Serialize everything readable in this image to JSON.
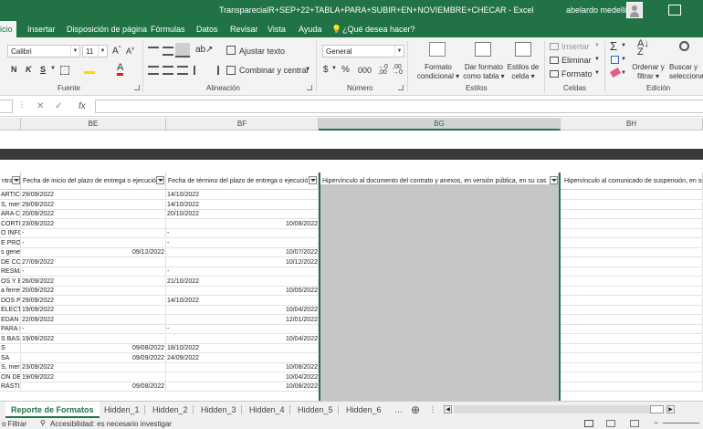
{
  "window": {
    "title": "TransparecialR+SEP+22+TABLA+PARA+SUBIR+EN+NOVIEMBRE+CHECAR  -  Excel",
    "user": "abelardo medellin"
  },
  "tabs": [
    {
      "label": "icio",
      "active": true
    },
    {
      "label": "Insertar"
    },
    {
      "label": "Disposición de página"
    },
    {
      "label": "Fórmulas"
    },
    {
      "label": "Datos"
    },
    {
      "label": "Revisar"
    },
    {
      "label": "Vista"
    },
    {
      "label": "Ayuda"
    },
    {
      "label": "¿Qué desea hacer?"
    }
  ],
  "ribbon": {
    "font_name": "Calibri",
    "font_size": "11",
    "bold": "N",
    "italic": "K",
    "underline": "S",
    "wrap_text": "Ajustar texto",
    "merge_center": "Combinar y centrar",
    "number_format": "General",
    "cond_format": [
      "Formato",
      "condicional"
    ],
    "format_table": [
      "Dar formato",
      "como tabla"
    ],
    "cell_styles": [
      "Estilos de",
      "celda"
    ],
    "insert": "Insertar",
    "delete": "Eliminar",
    "format": "Formato",
    "sort_filter": [
      "Ordenar y",
      "filtrar"
    ],
    "find_select": [
      "Buscar y",
      "seleccionar"
    ],
    "groups": {
      "font": "Fuente",
      "alignment": "Alineación",
      "number": "Número",
      "styles": "Estilos",
      "cells": "Celdas",
      "editing": "Edición"
    }
  },
  "formula_bar": {
    "fx": "fx",
    "value": ""
  },
  "columns": [
    "BE",
    "BF",
    "BG",
    "BH"
  ],
  "headers": {
    "a": "ntra",
    "be": "Fecha de inicio del plazo de entrega o ejecució",
    "bf": "Fecha de término del plazo de entrega o ejecució",
    "bg": "Hipervínculo al documento del contrato y anexos, en versión pública, en su cas",
    "bh": "Hipervínculo al comunicado de suspensión, en su"
  },
  "rows": [
    {
      "a": "ARTICULO",
      "be": "29/09/2022",
      "bf_l": "14/10/2022",
      "bf_r": ""
    },
    {
      "a": "S, menor",
      "be": "29/09/2022",
      "bf_l": "14/10/2022",
      "bf_r": ""
    },
    {
      "a": "ARA CÁM",
      "be": "20/09/2022",
      "bf_l": "20/10/2022",
      "bf_r": ""
    },
    {
      "a": "CORTINE",
      "be": "23/09/2022",
      "bf_l": "",
      "bf_r": "10/08/2022"
    },
    {
      "a": "O INFORM",
      "be": "-",
      "bf_l": "-",
      "bf_r": ""
    },
    {
      "a": "E PROTE",
      "be": "-",
      "bf_l": "-",
      "bf_r": ""
    },
    {
      "a": "s genera",
      "be_r": "09/12/2022",
      "bf_l": "",
      "bf_r": "10/07/2022"
    },
    {
      "a": "DE CONS",
      "be": "27/09/2022",
      "bf_l": "",
      "bf_r": "10/12/2022"
    },
    {
      "a": "RESMAL",
      "be": "-",
      "bf_l": "-",
      "bf_r": ""
    },
    {
      "a": "OS Y EQ",
      "be": "26/09/2022",
      "bf_l": "21/10/2022",
      "bf_r": ""
    },
    {
      "a": "a ferrete",
      "be": "20/09/2022",
      "bf_l": "",
      "bf_r": "10/05/2022"
    },
    {
      "a": "DOS PAR",
      "be": "29/09/2022",
      "bf_l": "14/10/2022",
      "bf_r": ""
    },
    {
      "a": "ELECTRIC",
      "be": "19/09/2022",
      "bf_l": "",
      "bf_r": "10/04/2022"
    },
    {
      "a": "EDÁN",
      "be": "22/09/2022",
      "bf_l": "",
      "bf_r": "12/01/2022"
    },
    {
      "a": "PARA L",
      "be": "-",
      "bf_l": "-",
      "bf_r": ""
    },
    {
      "a": "S BASI",
      "be": "19/09/2022",
      "bf_l": "",
      "bf_r": "10/04/2022"
    },
    {
      "a": "S",
      "be_r": "09/08/2022",
      "bf_l": "18/10/2022",
      "bf_r": ""
    },
    {
      "a": "SA",
      "be_r": "09/09/2022",
      "bf_l": "24/09/2022",
      "bf_r": ""
    },
    {
      "a": "S, menor",
      "be": "23/09/2022",
      "bf_l": "",
      "bf_r": "10/08/2022"
    },
    {
      "a": "ON DE SE",
      "be": "19/09/2022",
      "bf_l": "",
      "bf_r": "10/04/2022"
    },
    {
      "a": "RÁSTICO",
      "be_r": "09/08/2022",
      "bf_l": "",
      "bf_r": "10/08/2022"
    }
  ],
  "sheets": [
    "Reporte de Formatos",
    "Hidden_1",
    "Hidden_2",
    "Hidden_3",
    "Hidden_4",
    "Hidden_5",
    "Hidden_6"
  ],
  "status": {
    "filter": "o Filtrar",
    "accessibility": "Accesibilidad: es necesario investigar"
  }
}
